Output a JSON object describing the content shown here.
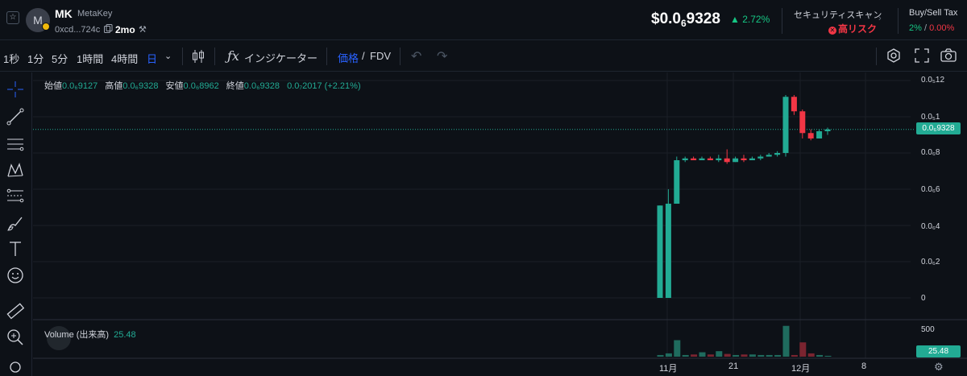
{
  "header": {
    "avatar_letter": "M",
    "symbol": "MK",
    "name": "MetaKey",
    "address": "0xcd...724c",
    "age": "2mo",
    "price_main": "$0.0",
    "price_sub": "6",
    "price_rest": "9328",
    "change": "2.72%",
    "security_title": "セキュリティスキャン",
    "risk_label": "高リスク",
    "tax_title": "Buy/Sell Tax",
    "tax_buy": "2%",
    "tax_sep": " / ",
    "tax_sell": "0.00%"
  },
  "toolbar": {
    "timeframes": [
      "1秒",
      "1分",
      "5分",
      "1時間",
      "4時間",
      "日"
    ],
    "active_timeframe": "日",
    "indicators_label": "インジケーター",
    "price_label": "価格",
    "slash": "/",
    "fdv_label": "FDV"
  },
  "chart": {
    "ohlc": {
      "open_label": "始値",
      "open": "0.0₆9127",
      "high_label": "高値",
      "high": "0.0₆9328",
      "low_label": "安値",
      "low": "0.0₆8962",
      "close_label": "終値",
      "close": "0.0₆9328",
      "change": "0.0₇2017 (+2.21%)"
    },
    "y_ticks": [
      "0.0₅12",
      "0.0₅1",
      "0.0₆8",
      "0.0₆6",
      "0.0₆4",
      "0.0₆2",
      "0"
    ],
    "current_price_tag": "0.0₆9328",
    "volume_label": "Volume (出来高)",
    "volume_value": "25.48",
    "volume_tick": "500",
    "volume_tag": "25.48",
    "x_ticks": [
      "11月",
      "21",
      "12月",
      "8"
    ]
  },
  "colors": {
    "up": "#22ab94",
    "down": "#f23645",
    "accent": "#2962ff",
    "background": "#0d1117"
  },
  "chart_data": {
    "type": "candlestick",
    "unit": "price ×1e-6",
    "candles": [
      {
        "o": 0.0,
        "h": 5.1,
        "l": 0.0,
        "c": 5.1
      },
      {
        "o": 0.0,
        "h": 6.0,
        "l": 0.0,
        "c": 5.2
      },
      {
        "o": 5.2,
        "h": 7.8,
        "l": 5.2,
        "c": 7.6
      },
      {
        "o": 7.6,
        "h": 7.8,
        "l": 7.5,
        "c": 7.7
      },
      {
        "o": 7.7,
        "h": 7.8,
        "l": 7.6,
        "c": 7.6
      },
      {
        "o": 7.6,
        "h": 7.8,
        "l": 7.6,
        "c": 7.7
      },
      {
        "o": 7.7,
        "h": 7.8,
        "l": 7.6,
        "c": 7.6
      },
      {
        "o": 7.6,
        "h": 7.9,
        "l": 7.5,
        "c": 7.7
      },
      {
        "o": 7.7,
        "h": 8.2,
        "l": 7.4,
        "c": 7.5
      },
      {
        "o": 7.5,
        "h": 7.8,
        "l": 7.5,
        "c": 7.7
      },
      {
        "o": 7.7,
        "h": 7.9,
        "l": 7.5,
        "c": 7.6
      },
      {
        "o": 7.6,
        "h": 7.8,
        "l": 7.6,
        "c": 7.7
      },
      {
        "o": 7.7,
        "h": 7.9,
        "l": 7.6,
        "c": 7.8
      },
      {
        "o": 7.8,
        "h": 8.0,
        "l": 7.8,
        "c": 7.9
      },
      {
        "o": 7.9,
        "h": 8.1,
        "l": 7.8,
        "c": 8.0
      },
      {
        "o": 8.0,
        "h": 11.2,
        "l": 7.8,
        "c": 11.1
      },
      {
        "o": 11.1,
        "h": 11.2,
        "l": 10.1,
        "c": 10.3
      },
      {
        "o": 10.3,
        "h": 10.4,
        "l": 8.8,
        "c": 9.1
      },
      {
        "o": 9.1,
        "h": 9.3,
        "l": 8.7,
        "c": 8.8
      },
      {
        "o": 8.8,
        "h": 9.3,
        "l": 8.8,
        "c": 9.2
      },
      {
        "o": 9.2,
        "h": 9.4,
        "l": 9.0,
        "c": 9.3
      }
    ],
    "volumes": [
      15,
      30,
      150,
      15,
      20,
      40,
      20,
      50,
      25,
      15,
      20,
      20,
      15,
      15,
      15,
      280,
      15,
      130,
      30,
      15,
      8
    ],
    "y_range": [
      0,
      12.5
    ],
    "x_tick_labels": [
      "11月",
      "21",
      "12月",
      "8"
    ]
  }
}
